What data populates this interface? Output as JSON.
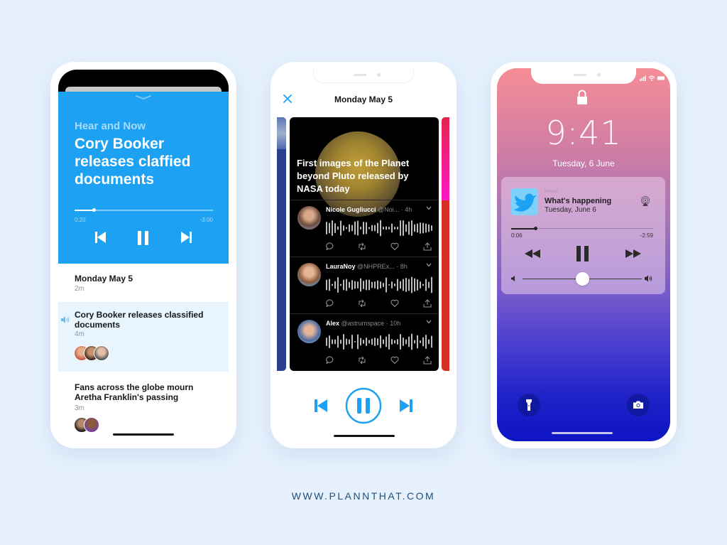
{
  "phone1": {
    "kicker": "Hear and Now",
    "title": "Cory Booker releases claffied documents",
    "player": {
      "elapsed": "0:20",
      "remaining": "-3:00",
      "progress": 0.14
    },
    "controls": {
      "prev": "skip-back",
      "play_state": "pause",
      "next": "skip-forward"
    },
    "episodes": [
      {
        "title": "Monday May 5",
        "duration": "2m",
        "active": false,
        "participants": 0
      },
      {
        "title": "Cory Booker releases classified documents",
        "duration": "4m",
        "active": true,
        "participants": 3
      },
      {
        "title": "Fans across the globe mourn Aretha Franklin's passing",
        "duration": "3m",
        "active": false,
        "participants": 2
      }
    ]
  },
  "phone2": {
    "header_title": "Monday May 5",
    "card": {
      "headline": "First images of the Planet beyond Pluto released by NASA today",
      "tweets": [
        {
          "name": "Nicole Gugliucci",
          "handle": "@Noi...",
          "time": "· 4h"
        },
        {
          "name": "LauraNoy",
          "handle": "@NHPREx...",
          "time": "· 8h"
        },
        {
          "name": "Alex",
          "handle": "@astrumspace",
          "time": "· 10h"
        }
      ]
    },
    "controls": {
      "prev": "skip-back",
      "play_state": "pause",
      "next": "skip-forward"
    }
  },
  "phone3": {
    "time": "9:41",
    "date": "Tuesday, 6 June",
    "now_playing": {
      "source": "iPhone",
      "title": "What's happening",
      "subtitle": "Tuesday, June 6",
      "elapsed": "0:06",
      "remaining": "-2:59",
      "progress": 0.17,
      "volume": 0.5
    }
  },
  "colors": {
    "accent": "#1da1f2",
    "footer": "#1f4f7a",
    "background": "#e6f1fd"
  },
  "footer": {
    "url": "WWW.PLANNTHAT.COM"
  }
}
